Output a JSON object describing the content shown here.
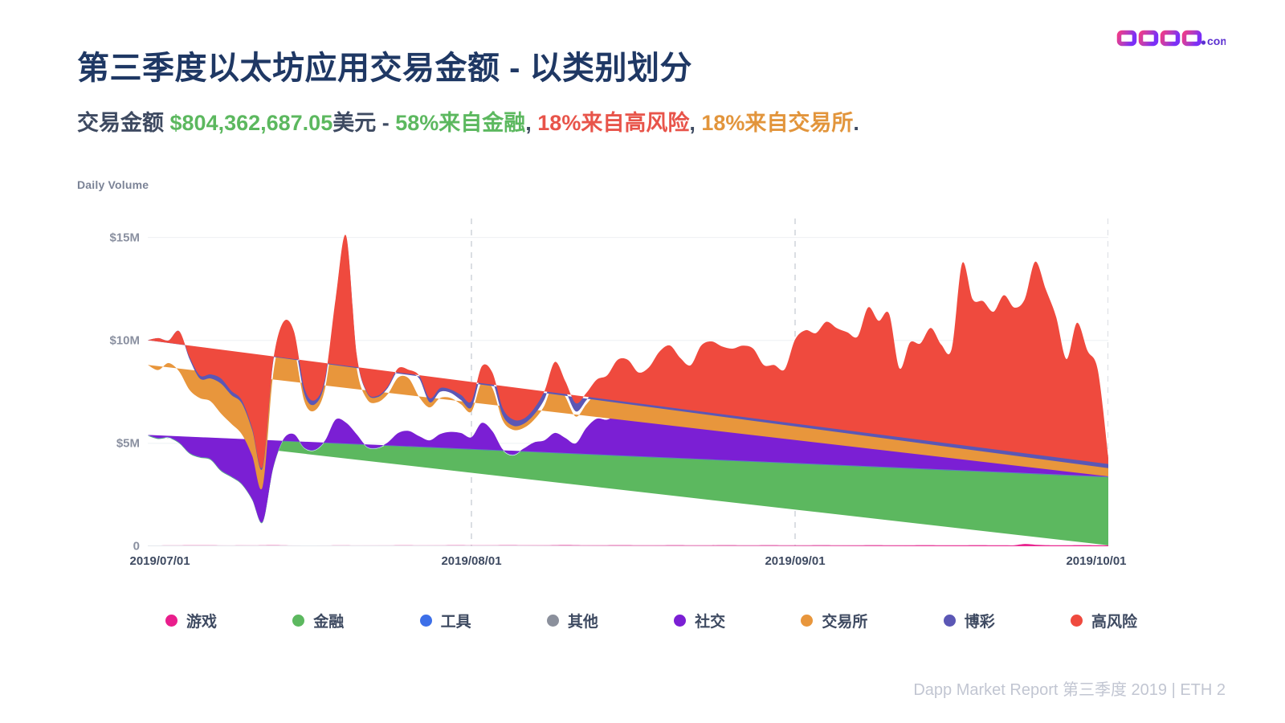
{
  "brand": {
    "name": "dapp",
    "suffix": ".com",
    "color_start": "#ec3b8b",
    "color_end": "#7b2ff7"
  },
  "header": {
    "title": "第三季度以太坊应用交易金额 - 以类别划分",
    "subtitle": {
      "lead": "交易金额 ",
      "amount": "$804,362,687.05",
      "unit": "美元",
      "sep1": " - ",
      "stat1": "58%来自金融",
      "comma1": ", ",
      "stat2": "18%来自高风险",
      "comma2": ", ",
      "stat3": "18%来自交易所",
      "end": "."
    }
  },
  "footer": {
    "text": "Dapp Market Report 第三季度 2019  |  ETH 2"
  },
  "legend": {
    "items": [
      {
        "label": "游戏",
        "color": "#e91e8c"
      },
      {
        "label": "金融",
        "color": "#5cb85f"
      },
      {
        "label": "工具",
        "color": "#3d6fe8"
      },
      {
        "label": "其他",
        "color": "#8b909c"
      },
      {
        "label": "社交",
        "color": "#7b1fd4"
      },
      {
        "label": "交易所",
        "color": "#e8963c"
      },
      {
        "label": "博彩",
        "color": "#5b57b5"
      },
      {
        "label": "高风险",
        "color": "#ef4a3e"
      }
    ]
  },
  "chart_data": {
    "type": "area",
    "stacked": true,
    "title": "",
    "xlabel": "",
    "ylabel": "Daily Volume",
    "ylim": [
      0,
      16000000
    ],
    "ytick_values": [
      0,
      5000000,
      10000000,
      15000000
    ],
    "ytick_labels": [
      "0",
      "$5M",
      "$10M",
      "$15M"
    ],
    "grid": "horizontal-light + vertical-dashed-at-month-starts",
    "legend_position": "bottom-center",
    "x_start": "2019/07/01",
    "x_end": "2019/10/01",
    "xtick_labels": [
      "2019/07/01",
      "2019/08/01",
      "2019/09/01",
      "2019/10/01"
    ],
    "xtick_positions": [
      0,
      31,
      62,
      92
    ],
    "x": [
      "2019/07/01",
      "2019/07/02",
      "2019/07/03",
      "2019/07/04",
      "2019/07/05",
      "2019/07/06",
      "2019/07/07",
      "2019/07/08",
      "2019/07/09",
      "2019/07/10",
      "2019/07/11",
      "2019/07/12",
      "2019/07/13",
      "2019/07/14",
      "2019/07/15",
      "2019/07/16",
      "2019/07/17",
      "2019/07/18",
      "2019/07/19",
      "2019/07/20",
      "2019/07/21",
      "2019/07/22",
      "2019/07/23",
      "2019/07/24",
      "2019/07/25",
      "2019/07/26",
      "2019/07/27",
      "2019/07/28",
      "2019/07/29",
      "2019/07/30",
      "2019/07/31",
      "2019/08/01",
      "2019/08/02",
      "2019/08/03",
      "2019/08/04",
      "2019/08/05",
      "2019/08/06",
      "2019/08/07",
      "2019/08/08",
      "2019/08/09",
      "2019/08/10",
      "2019/08/11",
      "2019/08/12",
      "2019/08/13",
      "2019/08/14",
      "2019/08/15",
      "2019/08/16",
      "2019/08/17",
      "2019/08/18",
      "2019/08/19",
      "2019/08/20",
      "2019/08/21",
      "2019/08/22",
      "2019/08/23",
      "2019/08/24",
      "2019/08/25",
      "2019/08/26",
      "2019/08/27",
      "2019/08/28",
      "2019/08/29",
      "2019/08/30",
      "2019/08/31",
      "2019/09/01",
      "2019/09/02",
      "2019/09/03",
      "2019/09/04",
      "2019/09/05",
      "2019/09/06",
      "2019/09/07",
      "2019/09/08",
      "2019/09/09",
      "2019/09/10",
      "2019/09/11",
      "2019/09/12",
      "2019/09/13",
      "2019/09/14",
      "2019/09/15",
      "2019/09/16",
      "2019/09/17",
      "2019/09/18",
      "2019/09/19",
      "2019/09/20",
      "2019/09/21",
      "2019/09/22",
      "2019/09/23",
      "2019/09/24",
      "2019/09/25",
      "2019/09/26",
      "2019/09/27",
      "2019/09/28",
      "2019/09/29",
      "2019/09/30",
      "2019/10/01"
    ],
    "series": [
      {
        "name": "游戏",
        "color": "#e91e8c",
        "values": [
          60000,
          60000,
          55000,
          55000,
          50000,
          50000,
          50000,
          55000,
          55000,
          50000,
          50000,
          55000,
          60000,
          55000,
          50000,
          50000,
          50000,
          50000,
          55000,
          55000,
          50000,
          50000,
          50000,
          50000,
          55000,
          55000,
          50000,
          50000,
          50000,
          55000,
          55000,
          50000,
          50000,
          50000,
          55000,
          55000,
          50000,
          50000,
          50000,
          55000,
          60000,
          55000,
          50000,
          50000,
          50000,
          55000,
          55000,
          50000,
          50000,
          50000,
          55000,
          55000,
          50000,
          50000,
          50000,
          55000,
          55000,
          50000,
          50000,
          55000,
          55000,
          50000,
          50000,
          50000,
          55000,
          55000,
          50000,
          50000,
          50000,
          55000,
          55000,
          50000,
          50000,
          50000,
          55000,
          55000,
          50000,
          50000,
          50000,
          55000,
          55000,
          50000,
          50000,
          50000,
          110000,
          75000,
          55000,
          50000,
          50000,
          55000,
          55000,
          50000,
          50000
        ]
      },
      {
        "name": "金融",
        "color": "#5cb85f",
        "values": [
          5300000,
          5150000,
          5200000,
          4950000,
          4450000,
          4250000,
          4150000,
          3600000,
          3300000,
          2950000,
          2200000,
          1100000,
          3700000,
          5100000,
          5350000,
          4700000,
          4600000,
          5050000,
          6050000,
          5900000,
          5350000,
          4750000,
          4700000,
          4950000,
          5400000,
          5500000,
          5250000,
          5050000,
          5350000,
          5450000,
          5400000,
          5200000,
          5900000,
          5500000,
          4600000,
          4350000,
          4650000,
          4950000,
          5050000,
          5400000,
          5150000,
          4900000,
          5650000,
          6100000,
          6050000,
          6300000,
          6450000,
          6200000,
          6350000,
          6600000,
          6500000,
          6100000,
          6000000,
          6400000,
          6350000,
          6700000,
          6900000,
          7000000,
          6800000,
          6300000,
          6050000,
          5950000,
          5900000,
          6100000,
          6250000,
          6300000,
          6000000,
          5950000,
          5800000,
          6100000,
          6200000,
          6000000,
          5850000,
          5700000,
          5500000,
          5900000,
          5600000,
          5400000,
          5200000,
          5650000,
          5800000,
          5500000,
          5300000,
          5050000,
          5450000,
          6300000,
          5600000,
          4700000,
          4200000,
          4700000,
          4000000,
          3500000,
          3300000
        ]
      },
      {
        "name": "工具",
        "color": "#3d6fe8",
        "values": [
          25000,
          25000,
          20000,
          20000,
          20000,
          20000,
          25000,
          25000,
          20000,
          20000,
          20000,
          20000,
          25000,
          25000,
          20000,
          20000,
          20000,
          25000,
          25000,
          20000,
          20000,
          20000,
          20000,
          25000,
          25000,
          20000,
          20000,
          20000,
          25000,
          25000,
          20000,
          20000,
          20000,
          20000,
          25000,
          25000,
          20000,
          20000,
          20000,
          25000,
          25000,
          20000,
          20000,
          20000,
          25000,
          25000,
          20000,
          20000,
          20000,
          25000,
          25000,
          20000,
          20000,
          20000,
          25000,
          25000,
          20000,
          20000,
          20000,
          25000,
          25000,
          20000,
          20000,
          20000,
          25000,
          25000,
          20000,
          20000,
          20000,
          25000,
          25000,
          20000,
          20000,
          20000,
          25000,
          25000,
          20000,
          20000,
          20000,
          25000,
          25000,
          20000,
          20000,
          20000,
          25000,
          25000,
          20000,
          20000,
          20000,
          25000,
          25000,
          20000,
          20000
        ]
      },
      {
        "name": "其他",
        "color": "#8b909c",
        "values": [
          15000,
          15000,
          15000,
          15000,
          15000,
          15000,
          15000,
          15000,
          15000,
          15000,
          15000,
          15000,
          15000,
          15000,
          15000,
          15000,
          15000,
          15000,
          15000,
          15000,
          15000,
          15000,
          15000,
          15000,
          15000,
          15000,
          15000,
          15000,
          15000,
          15000,
          15000,
          15000,
          15000,
          15000,
          15000,
          15000,
          15000,
          15000,
          15000,
          15000,
          15000,
          15000,
          15000,
          15000,
          15000,
          15000,
          15000,
          15000,
          15000,
          15000,
          15000,
          15000,
          15000,
          15000,
          15000,
          15000,
          15000,
          15000,
          15000,
          15000,
          15000,
          15000,
          15000,
          15000,
          15000,
          15000,
          15000,
          15000,
          15000,
          15000,
          15000,
          15000,
          15000,
          15000,
          15000,
          15000,
          15000,
          15000,
          15000,
          15000,
          15000,
          15000,
          15000,
          15000,
          15000,
          15000,
          15000,
          15000,
          15000,
          15000,
          15000,
          15000,
          15000
        ]
      },
      {
        "name": "社交",
        "color": "#7b1fd4",
        "values": [
          10000,
          10000,
          10000,
          10000,
          10000,
          10000,
          10000,
          10000,
          10000,
          10000,
          10000,
          10000,
          10000,
          10000,
          10000,
          10000,
          10000,
          10000,
          10000,
          10000,
          10000,
          10000,
          10000,
          10000,
          10000,
          10000,
          10000,
          10000,
          10000,
          10000,
          10000,
          10000,
          10000,
          10000,
          10000,
          10000,
          10000,
          10000,
          10000,
          10000,
          10000,
          10000,
          10000,
          10000,
          10000,
          10000,
          10000,
          10000,
          10000,
          10000,
          10000,
          10000,
          10000,
          10000,
          10000,
          10000,
          10000,
          10000,
          10000,
          10000,
          10000,
          10000,
          10000,
          10000,
          10000,
          10000,
          10000,
          10000,
          10000,
          10000,
          10000,
          10000,
          10000,
          10000,
          10000,
          10000,
          10000,
          10000,
          10000,
          10000,
          10000,
          10000,
          10000,
          10000,
          10000,
          10000,
          10000,
          10000,
          10000,
          10000,
          10000,
          10000,
          10000
        ]
      },
      {
        "name": "交易所",
        "color": "#e8963c",
        "values": [
          3400000,
          3300000,
          3600000,
          3450000,
          3050000,
          2850000,
          2800000,
          2750000,
          2550000,
          2400000,
          2100000,
          1700000,
          4500000,
          5200000,
          4200000,
          2250000,
          1900000,
          2550000,
          5100000,
          7600000,
          3250000,
          2300000,
          2200000,
          2350000,
          2700000,
          2550000,
          1900000,
          1600000,
          1750000,
          1650000,
          1400000,
          1250000,
          2000000,
          2100000,
          1400000,
          1200000,
          1000000,
          1100000,
          1700000,
          2600000,
          2000000,
          1300000,
          1150000,
          1250000,
          1400000,
          1800000,
          1600000,
          1350000,
          1500000,
          1850000,
          2100000,
          2000000,
          1850000,
          2200000,
          2300000,
          1800000,
          1600000,
          1500000,
          1400000,
          1250000,
          1500000,
          1350000,
          1200000,
          1200000,
          1100000,
          1150000,
          1300000,
          1400000,
          1250000,
          1100000,
          1000000,
          950000,
          900000,
          850000,
          800000,
          1100000,
          900000,
          750000,
          700000,
          650000,
          600000,
          700000,
          900000,
          800000,
          700000,
          1200000,
          900000,
          600000,
          500000,
          750000,
          550000,
          450000,
          400000
        ]
      },
      {
        "name": "博彩",
        "color": "#5b57b5",
        "values": [
          1200000,
          1550000,
          1100000,
          1950000,
          1500000,
          950000,
          1100000,
          1450000,
          1400000,
          1500000,
          1250000,
          900000,
          600000,
          450000,
          400000,
          350000,
          300000,
          350000,
          700000,
          1400000,
          600000,
          300000,
          250000,
          300000,
          350000,
          300000,
          900000,
          250000,
          300000,
          250000,
          200000,
          200000,
          400000,
          350000,
          250000,
          200000,
          200000,
          250000,
          300000,
          350000,
          300000,
          250000,
          200000,
          250000,
          300000,
          350000,
          300000,
          250000,
          250000,
          300000,
          350000,
          300000,
          250000,
          350000,
          400000,
          350000,
          300000,
          350000,
          400000,
          300000,
          350000,
          300000,
          250000,
          400000,
          500000,
          550000,
          600000,
          450000,
          350000,
          400000,
          450000,
          350000,
          300000,
          250000,
          250000,
          400000,
          300000,
          250000,
          250000,
          400000,
          500000,
          400000,
          300000,
          250000,
          500000,
          400000,
          300000,
          250000,
          400000,
          300000,
          250000,
          200000,
          200000
        ]
      },
      {
        "name": "高风险",
        "color": "#ef4a3e",
        "values": [
          0,
          0,
          0,
          0,
          100000,
          150000,
          200000,
          250000,
          200000,
          150000,
          100000,
          80000,
          60000,
          50000,
          400000,
          300000,
          200000,
          150000,
          100000,
          80000,
          60000,
          50000,
          60000,
          80000,
          100000,
          120000,
          150000,
          200000,
          180000,
          160000,
          250000,
          300000,
          350000,
          400000,
          350000,
          300000,
          250000,
          300000,
          400000,
          500000,
          450000,
          400000,
          350000,
          400000,
          450000,
          500000,
          600000,
          550000,
          500000,
          600000,
          700000,
          650000,
          600000,
          700000,
          800000,
          750000,
          700000,
          800000,
          900000,
          850000,
          800000,
          900000,
          2600000,
          2700000,
          2400000,
          2800000,
          2600000,
          2500000,
          2700000,
          3900000,
          3200000,
          3900000,
          1500000,
          3000000,
          3200000,
          3100000,
          2900000,
          3100000,
          7500000,
          5200000,
          4900000,
          4700000,
          5600000,
          5400000,
          5200000,
          5800000,
          5600000,
          5500000,
          3900000,
          5000000,
          4600000,
          4300000,
          300000
        ]
      }
    ]
  }
}
